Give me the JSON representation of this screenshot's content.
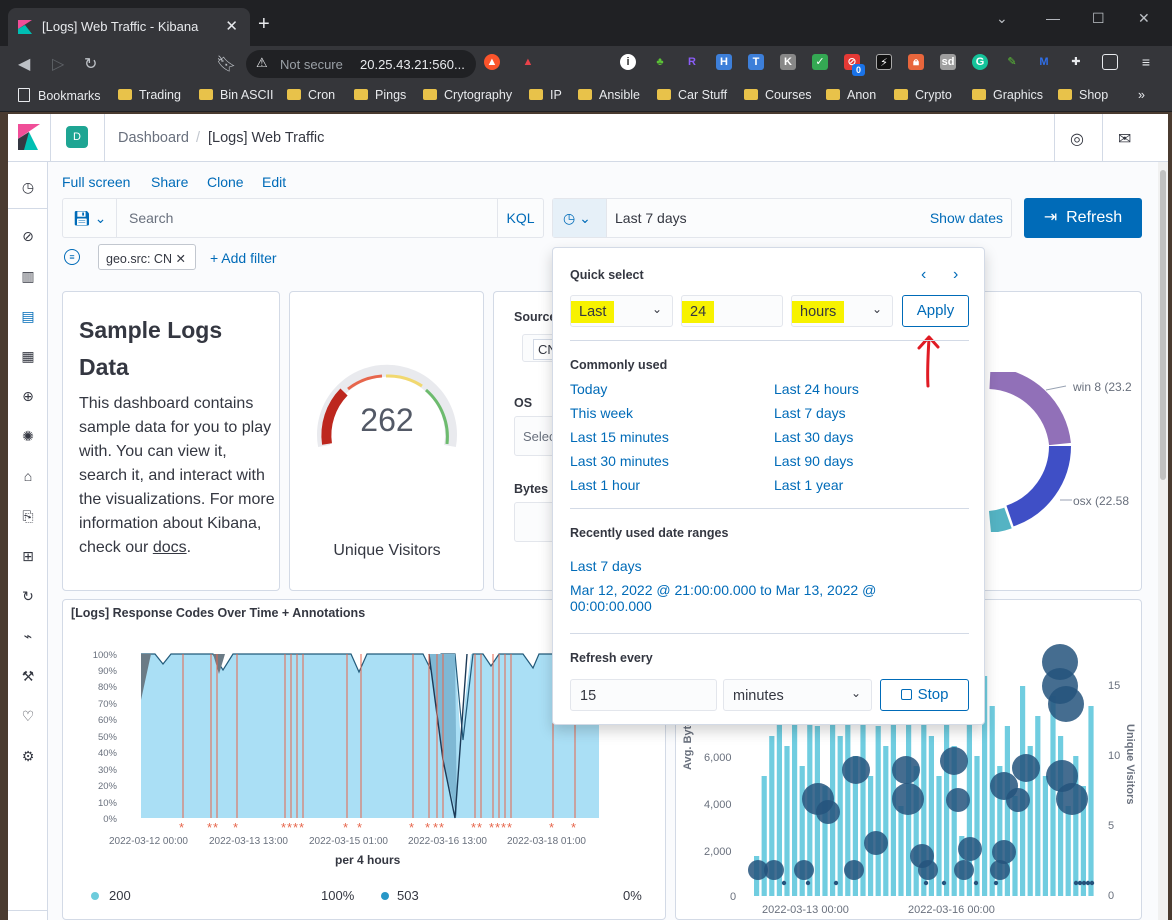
{
  "browser": {
    "tab_title": "[Logs] Web Traffic - Kibana",
    "not_secure": "Not secure",
    "url": "20.25.43.21:560...",
    "bookmarks": [
      "Bookmarks",
      "Trading",
      "Bin ASCII",
      "Cron",
      "Pings",
      "Crytography",
      "IP",
      "Ansible",
      "Car Stuff",
      "Courses",
      "Anon",
      "Crypto",
      "Graphics",
      "Shop"
    ],
    "ext_badge": "0"
  },
  "header": {
    "space_initial": "D",
    "breadcrumb_root": "Dashboard",
    "breadcrumb_current": "[Logs] Web Traffic"
  },
  "toplinks": [
    "Full screen",
    "Share",
    "Clone",
    "Edit"
  ],
  "search": {
    "placeholder": "Search",
    "language": "KQL"
  },
  "datepicker": {
    "range": "Last 7 days",
    "show_dates": "Show dates"
  },
  "refresh_label": "Refresh",
  "filters": {
    "pill": "geo.src: CN",
    "add_filter": "+ Add filter"
  },
  "markdown": {
    "title": "Sample Logs Data",
    "body_pre": "This dashboard contains sample data for you to play with. You can view it, search it, and interact with the visualizations. For more information about Kibana, check our ",
    "body_link": "docs",
    "body_post": "."
  },
  "gauge": {
    "value": "262",
    "label": "Unique Visitors"
  },
  "controls": {
    "source_label": "Source",
    "source_value": "CN",
    "os_label": "OS",
    "os_placeholder": "Selec",
    "bytes_label": "Bytes"
  },
  "donut": {
    "labels": [
      "win 8 (23.2",
      "osx (22.58"
    ]
  },
  "response_chart": {
    "title": "[Logs] Response Codes Over Time + Annotations",
    "y_ticks": [
      "100%",
      "90%",
      "80%",
      "70%",
      "60%",
      "50%",
      "40%",
      "30%",
      "20%",
      "10%",
      "0%"
    ],
    "x_ticks": [
      "2022-03-12 00:00",
      "2022-03-13 13:00",
      "2022-03-15 01:00",
      "2022-03-16 13:00",
      "2022-03-18 01:00"
    ],
    "x_label": "per 4 hours",
    "legend": [
      {
        "name": "200",
        "value": "100%",
        "color": "#6dccb1"
      },
      {
        "name": "503",
        "value": "0%",
        "color": "#2897c7"
      }
    ]
  },
  "bytes_chart": {
    "y_left_label": "Avg. Bytes",
    "y_left_ticks": [
      "6,000",
      "4,000",
      "2,000",
      "0"
    ],
    "y_right_label": "Unique Visitors",
    "y_right_ticks": [
      "15",
      "10",
      "5",
      "0"
    ],
    "x_ticks": [
      "2022-03-13 00:00",
      "2022-03-16 00:00"
    ]
  },
  "popover": {
    "quick_select": "Quick select",
    "tense": "Last",
    "value": "24",
    "unit": "hours",
    "apply": "Apply",
    "commonly_used_title": "Commonly used",
    "commonly_used_left": [
      "Today",
      "This week",
      "Last 15 minutes",
      "Last 30 minutes",
      "Last 1 hour"
    ],
    "commonly_used_right": [
      "Last 24 hours",
      "Last 7 days",
      "Last 30 days",
      "Last 90 days",
      "Last 1 year"
    ],
    "recent_title": "Recently used date ranges",
    "recent": [
      "Last 7 days",
      "Mar 12, 2022 @ 21:00:00.000 to Mar 13, 2022 @",
      "00:00:00.000"
    ],
    "refresh_title": "Refresh every",
    "refresh_value": "15",
    "refresh_unit": "minutes",
    "stop": "Stop"
  },
  "colors": {
    "accent": "#006bb8",
    "highlight": "#f7f200",
    "annotation": "#e7664c",
    "area": "#aadff5"
  }
}
